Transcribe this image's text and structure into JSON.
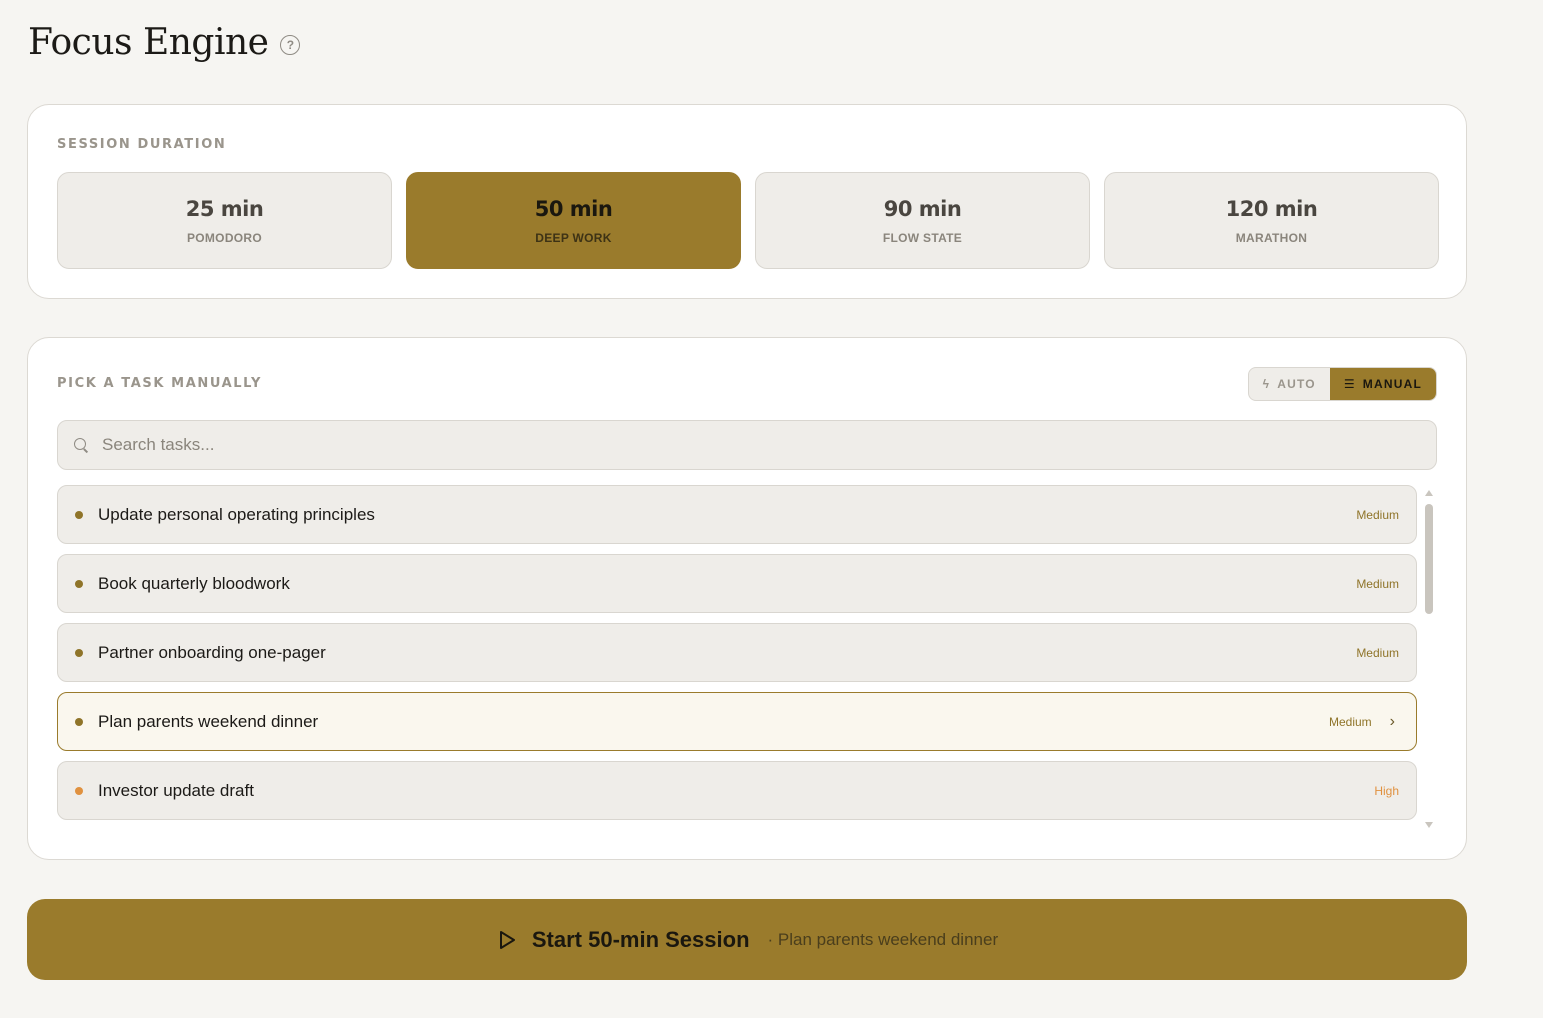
{
  "header": {
    "title": "Focus Engine",
    "help_icon": "?"
  },
  "duration": {
    "label": "SESSION DURATION",
    "options": [
      {
        "value": "25 min",
        "name": "POMODORO",
        "active": false
      },
      {
        "value": "50 min",
        "name": "DEEP WORK",
        "active": true
      },
      {
        "value": "90 min",
        "name": "FLOW STATE",
        "active": false
      },
      {
        "value": "120 min",
        "name": "MARATHON",
        "active": false
      }
    ]
  },
  "tasks_card": {
    "label": "PICK A TASK MANUALLY",
    "mode": {
      "auto_label": "AUTO",
      "manual_label": "MANUAL",
      "selected": "MANUAL"
    },
    "search": {
      "placeholder": "Search tasks...",
      "value": ""
    },
    "items": [
      {
        "title": "Update personal operating principles",
        "priority": "Medium",
        "selected": false
      },
      {
        "title": "Book quarterly bloodwork",
        "priority": "Medium",
        "selected": false
      },
      {
        "title": "Partner onboarding one-pager",
        "priority": "Medium",
        "selected": false
      },
      {
        "title": "Plan parents weekend dinner",
        "priority": "Medium",
        "selected": true
      },
      {
        "title": "Investor update draft",
        "priority": "High",
        "selected": false
      }
    ]
  },
  "start": {
    "label": "Start 50-min Session",
    "task": "· Plan parents weekend dinner"
  },
  "colors": {
    "accent": "#9a7b2c",
    "medium": "#8f7429",
    "high": "#e0913f",
    "background": "#f6f5f2"
  }
}
